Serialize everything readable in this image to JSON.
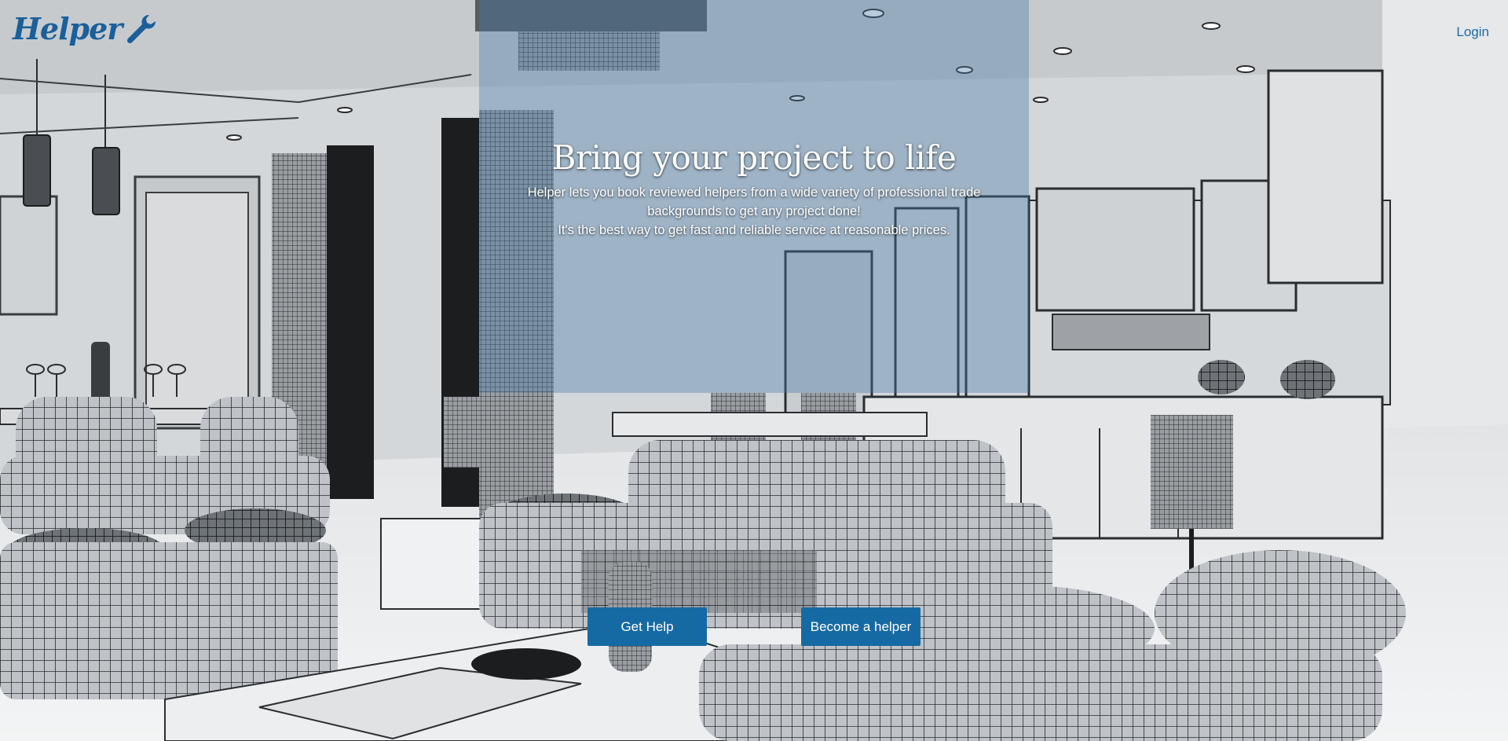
{
  "header": {
    "logo_text": "Helper",
    "logo_icon": "wrench-icon",
    "login_label": "Login"
  },
  "hero": {
    "title": "Bring your project to life",
    "description_line1": "Helper lets you book reviewed helpers from a wide variety of professional trade backgrounds to get any project done!",
    "description_line2": "It's the best way to get fast and reliable service at reasonable prices."
  },
  "actions": {
    "get_help_label": "Get Help",
    "become_helper_label": "Become a helper"
  },
  "colors": {
    "brand_blue": "#1a5f9a",
    "button_blue": "#166aa3",
    "panel_tint": "rgba(70,120,165,0.38)"
  },
  "background": {
    "description_icon": "interior-wireframe-image"
  }
}
